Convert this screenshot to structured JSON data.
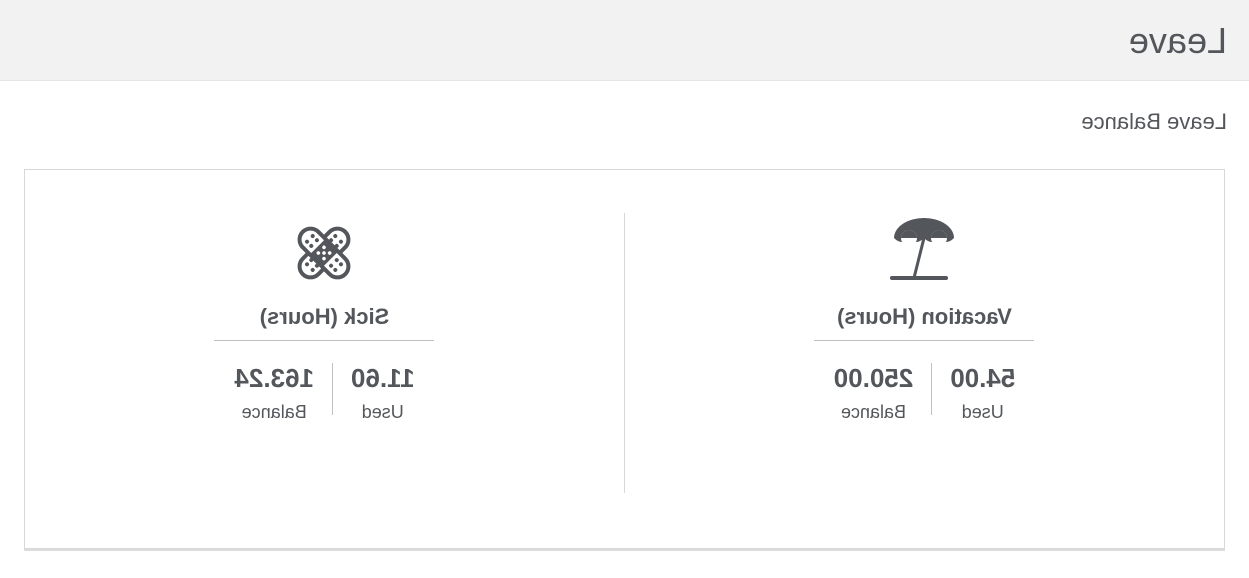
{
  "header": {
    "title": "Leave"
  },
  "section": {
    "title": "Leave Balance"
  },
  "cards": [
    {
      "icon": "umbrella-icon",
      "title": "Vacation (Hours)",
      "used_value": "54.00",
      "used_label": "Used",
      "balance_value": "250.00",
      "balance_label": "Balance"
    },
    {
      "icon": "bandage-icon",
      "title": "Sick (Hours)",
      "used_value": "11.60",
      "used_label": "Used",
      "balance_value": "163.24",
      "balance_label": "Balance"
    }
  ]
}
